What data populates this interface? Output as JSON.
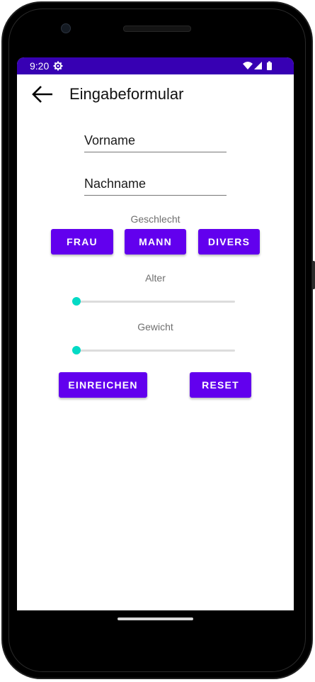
{
  "status_bar": {
    "time": "9:20",
    "background": "#3700b3",
    "icons": [
      "settings-gear-icon",
      "wifi-icon",
      "signal-icon",
      "battery-icon"
    ]
  },
  "app_bar": {
    "title": "Eingabeformular",
    "back_icon": "arrow-back-icon"
  },
  "form": {
    "first_name": {
      "placeholder": "Vorname",
      "value": ""
    },
    "last_name": {
      "placeholder": "Nachname",
      "value": ""
    },
    "gender": {
      "label": "Geschlecht",
      "options": [
        "FRAU",
        "MANN",
        "DIVERS"
      ]
    },
    "age": {
      "label": "Alter",
      "value_fraction": 0
    },
    "weight": {
      "label": "Gewicht",
      "value_fraction": 0
    },
    "submit_label": "EINREICHEN",
    "reset_label": "RESET"
  },
  "colors": {
    "primary": "#6200ee",
    "primary_dark": "#3700b3",
    "accent": "#03dac5"
  }
}
